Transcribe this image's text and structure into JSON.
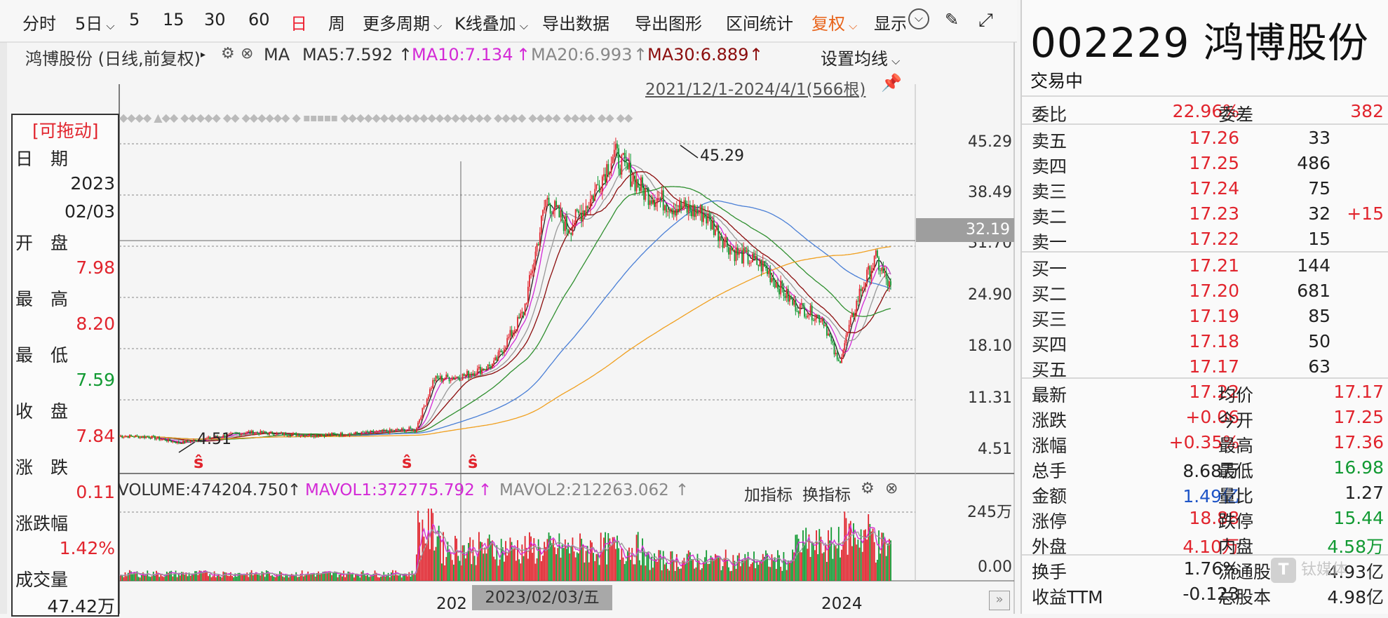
{
  "toolbar": {
    "items": [
      "分时",
      "5日",
      "5",
      "15",
      "30",
      "60",
      "日",
      "周",
      "更多周期",
      "K线叠加",
      "导出数据",
      "导出图形",
      "区间统计",
      "复权",
      "显示"
    ],
    "active": "日",
    "fuquan": "复权"
  },
  "infobar": {
    "stock_label": "鸿博股份 (日线,前复权)",
    "ma_label": "MA",
    "ma5": "MA5:7.592",
    "ma10": "MA10:7.134",
    "ma20": "MA20:6.993",
    "ma30": "MA30:6.889",
    "set_ma": "设置均线",
    "range": "2021/12/1-2024/4/1(566根)"
  },
  "price_axis": [
    "45.29",
    "38.49",
    "31.70",
    "24.90",
    "18.10",
    "11.31",
    "4.51"
  ],
  "current_price_tag": "32.19",
  "annotations": {
    "high": "45.29",
    "low": "4.51"
  },
  "volume_bar": {
    "volume": "VOLUME:474204.750",
    "mavol1": "MAVOL1:372775.792",
    "mavol2": "MAVOL2:212263.062",
    "add_indicator": "加指标",
    "switch_indicator": "换指标",
    "axis_top": "245万",
    "axis_bottom": "0.00"
  },
  "xaxis": {
    "cursor_date": "2023/02/03/五",
    "year_left": "202",
    "year_right": "2024"
  },
  "tip": {
    "drag": "[可拖动]",
    "date_label": "日　期",
    "year": "2023",
    "mmdd": "02/03",
    "open_label": "开　盘",
    "open": "7.98",
    "high_label": "最　高",
    "high": "8.20",
    "low_label": "最　低",
    "low": "7.59",
    "close_label": "收　盘",
    "close": "7.84",
    "change_label": "涨　跌",
    "change": "0.11",
    "pct_label": "涨跌幅",
    "pct": "1.42%",
    "vol_label": "成交量",
    "vol": "47.42万"
  },
  "quote": {
    "code_name": "002229 鸿博股份",
    "status": "交易中",
    "weibi_label": "委比",
    "weibi": "22.96%",
    "weicha_label": "委差",
    "weicha": "382",
    "sell": [
      {
        "label": "卖五",
        "price": "17.26",
        "vol": "33",
        "extra": ""
      },
      {
        "label": "卖四",
        "price": "17.25",
        "vol": "486",
        "extra": ""
      },
      {
        "label": "卖三",
        "price": "17.24",
        "vol": "75",
        "extra": ""
      },
      {
        "label": "卖二",
        "price": "17.23",
        "vol": "32",
        "extra": "+15"
      },
      {
        "label": "卖一",
        "price": "17.22",
        "vol": "15",
        "extra": ""
      }
    ],
    "buy": [
      {
        "label": "买一",
        "price": "17.21",
        "vol": "144"
      },
      {
        "label": "买二",
        "price": "17.20",
        "vol": "681"
      },
      {
        "label": "买三",
        "price": "17.19",
        "vol": "85"
      },
      {
        "label": "买四",
        "price": "17.18",
        "vol": "50"
      },
      {
        "label": "买五",
        "price": "17.17",
        "vol": "63"
      }
    ],
    "stats": [
      {
        "l1": "最新",
        "v1": "17.22",
        "l2": "均价",
        "v2": "17.17"
      },
      {
        "l1": "涨跌",
        "v1": "+0.06",
        "l2": "今开",
        "v2": "17.25"
      },
      {
        "l1": "涨幅",
        "v1": "+0.35%",
        "l2": "最高",
        "v2": "17.36"
      },
      {
        "l1": "总手",
        "v1": "8.68万",
        "l2": "最低",
        "v2": "16.98"
      },
      {
        "l1": "金额",
        "v1": "1.49亿",
        "l2": "量比",
        "v2": "1.27"
      },
      {
        "l1": "涨停",
        "v1": "18.88",
        "l2": "跌停",
        "v2": "15.44"
      },
      {
        "l1": "外盘",
        "v1": "4.10万",
        "l2": "内盘",
        "v2": "4.58万"
      }
    ],
    "stats2": [
      {
        "l1": "换手",
        "v1": "1.76%",
        "l2": "流通股",
        "v2": "4.93亿"
      },
      {
        "l1": "收益TTM",
        "v1": "-0.123",
        "l2": "总股本",
        "v2": "4.98亿"
      }
    ],
    "watermark": "钛媒体"
  },
  "colors": {
    "up": "#e1242d",
    "down": "#129a33",
    "ma5": "#222222",
    "ma10": "#d32ad6",
    "ma20": "#999999",
    "ma30": "#8b0d0d",
    "ma60": "#2f8f2f",
    "ma120": "#4a7fd6",
    "ma250": "#f0a020"
  }
}
